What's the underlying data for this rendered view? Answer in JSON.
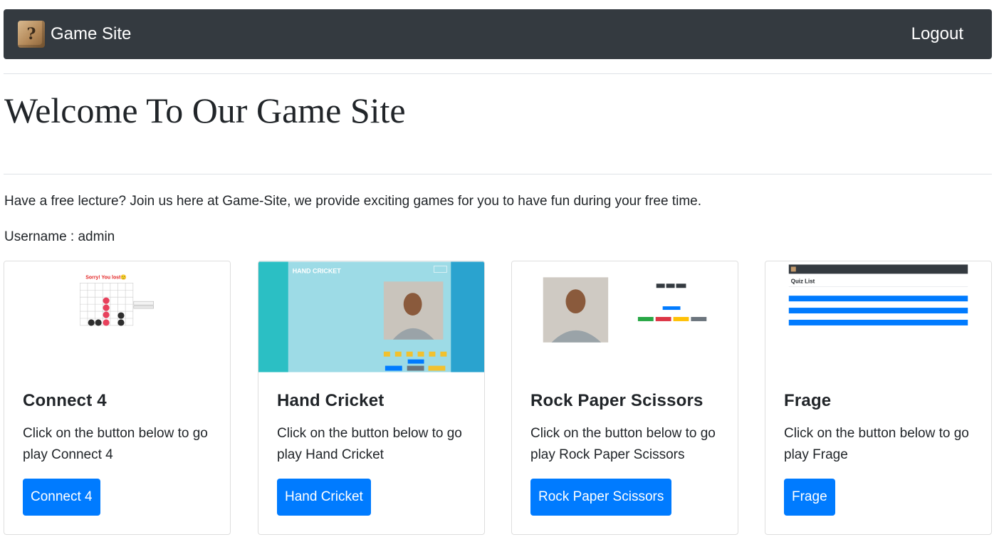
{
  "navbar": {
    "brand_glyph": "?",
    "brand": "Game Site",
    "logout": "Logout"
  },
  "page": {
    "title": "Welcome To Our Game Site",
    "intro": "Have a free lecture? Join us here at Game-Site, we provide exciting games for you to have fun during your free time.",
    "username": "Username : admin"
  },
  "cards": [
    {
      "title": "Connect 4",
      "text": "Click on the button below to go play Connect 4",
      "button": "Connect 4",
      "preview_text": "Sorry! You lost🙂"
    },
    {
      "title": "Hand Cricket",
      "text": "Click on the button below to go play Hand Cricket",
      "button": "Hand Cricket",
      "preview_text": "HAND CRICKET"
    },
    {
      "title": "Rock Paper Scissors",
      "text": "Click on the button below to go play Rock Paper Scissors",
      "button": "Rock Paper Scissors"
    },
    {
      "title": "Frage",
      "text": "Click on the button below to go play Frage",
      "button": "Frage",
      "preview_text": "Quiz List"
    }
  ],
  "colors": {
    "navbar_bg": "#343a40",
    "primary": "#007bff",
    "cricket_teal": "#2bbfc4",
    "cricket_light": "#9ddbe6",
    "connect_red": "#e8415c"
  }
}
